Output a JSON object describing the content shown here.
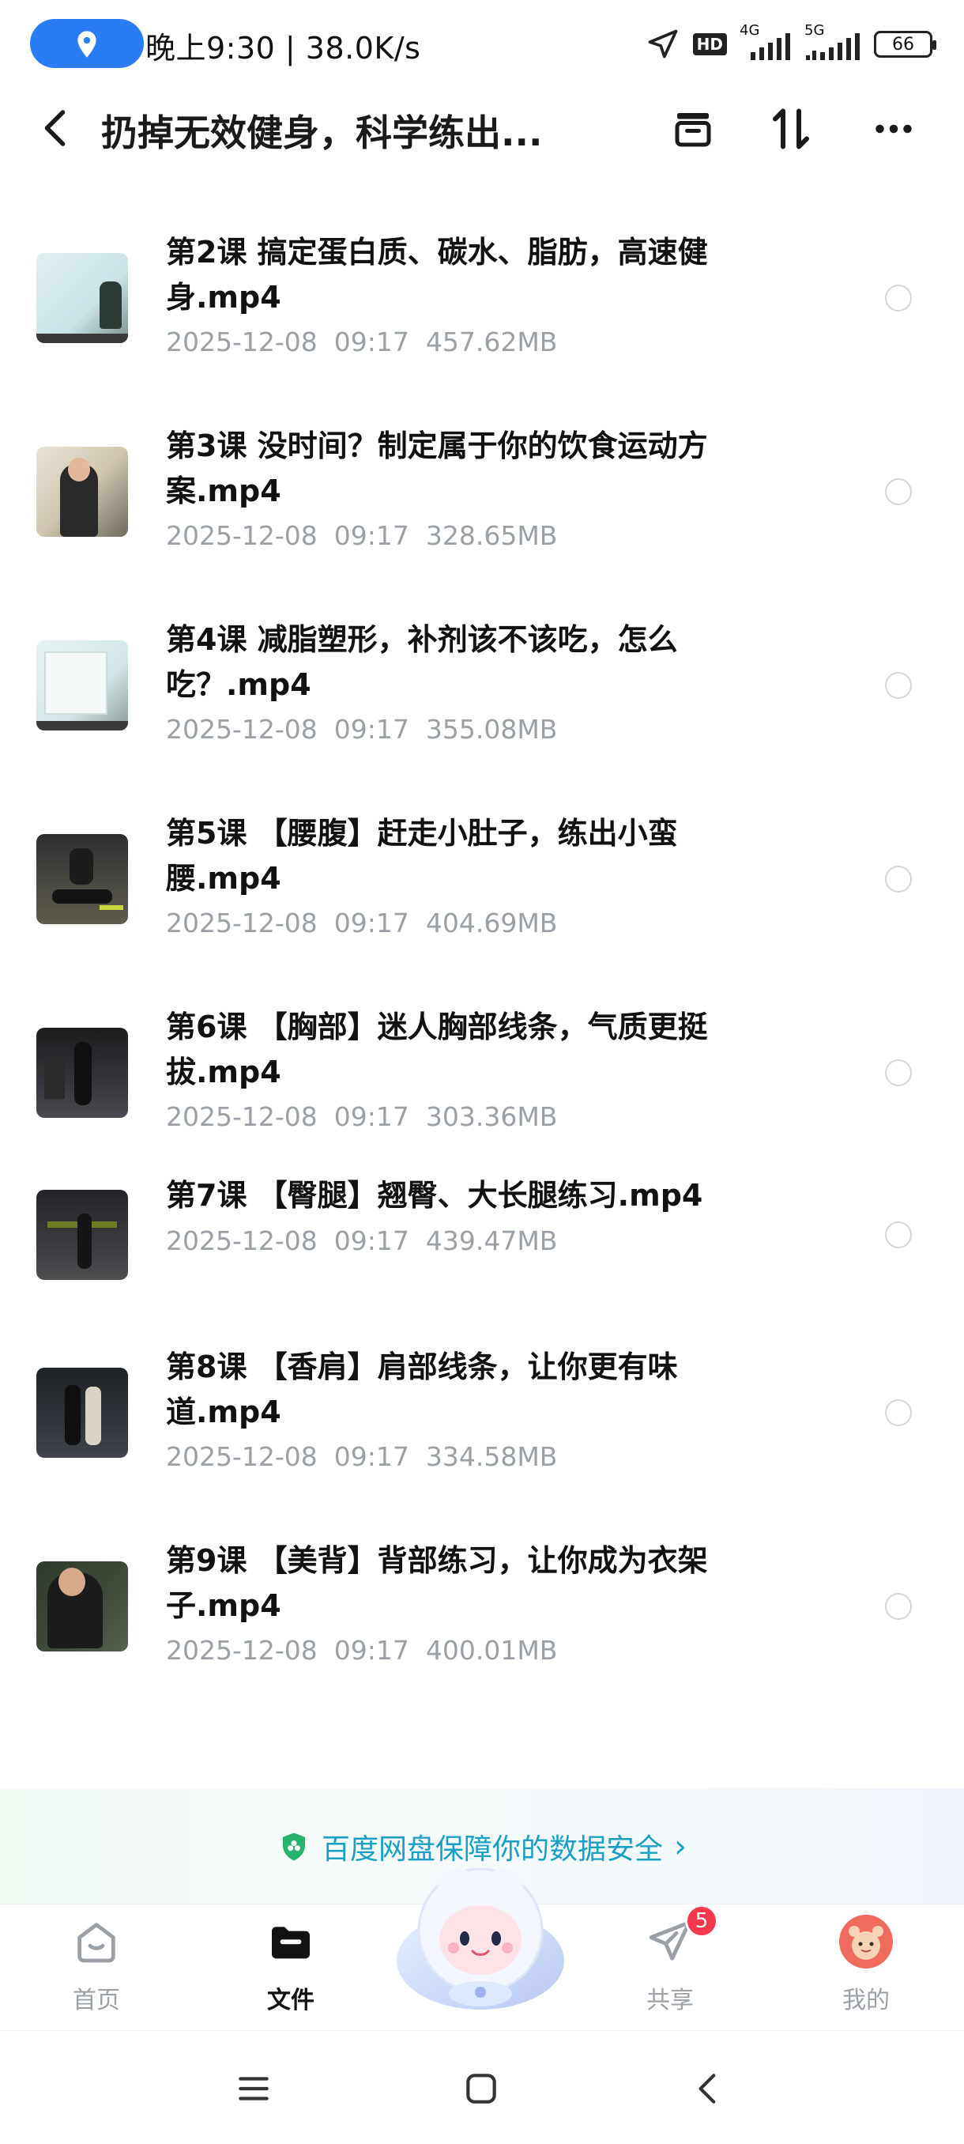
{
  "status_bar": {
    "time_speed": "晚上9:30 | 38.0K/s",
    "hd_label": "HD",
    "net1": "4G",
    "net2": "5G",
    "battery": "66"
  },
  "header": {
    "title": "扔掉无效健身，科学练出...",
    "icons": [
      "back-icon",
      "inbox-icon",
      "sort-icon",
      "more-icon"
    ]
  },
  "files": [
    {
      "name": "第2课 搞定蛋白质、碳水、脂肪，高速健身.mp4",
      "date": "2025-12-08",
      "time": "09:17",
      "size": "457.62MB",
      "lines": 2
    },
    {
      "name": "第3课 没时间？制定属于你的饮食运动方案.mp4",
      "date": "2025-12-08",
      "time": "09:17",
      "size": "328.65MB",
      "lines": 2
    },
    {
      "name": "第4课 减脂塑形，补剂该不该吃，怎么吃？.mp4",
      "date": "2025-12-08",
      "time": "09:17",
      "size": "355.08MB",
      "lines": 2
    },
    {
      "name": "第5课 【腰腹】赶走小肚子，练出小蛮腰.mp4",
      "date": "2025-12-08",
      "time": "09:17",
      "size": "404.69MB",
      "lines": 2
    },
    {
      "name": "第6课 【胸部】迷人胸部线条，气质更挺拔.mp4",
      "date": "2025-12-08",
      "time": "09:17",
      "size": "303.36MB",
      "lines": 2
    },
    {
      "name": "第7课 【臀腿】翘臀、大长腿练习.mp4",
      "date": "2025-12-08",
      "time": "09:17",
      "size": "439.47MB",
      "lines": 1
    },
    {
      "name": "第8课 【香肩】肩部线条，让你更有味道.mp4",
      "date": "2025-12-08",
      "time": "09:17",
      "size": "334.58MB",
      "lines": 2
    },
    {
      "name": "第9课 【美背】背部练习，让你成为衣架子.mp4",
      "date": "2025-12-08",
      "time": "09:17",
      "size": "400.01MB",
      "lines": 2
    }
  ],
  "safety_banner": {
    "text": "百度网盘保障你的数据安全",
    "arrow": "›"
  },
  "bottom_nav": {
    "items": [
      {
        "label": "首页",
        "icon": "home-icon",
        "active": false
      },
      {
        "label": "文件",
        "icon": "folder-icon",
        "active": true
      },
      {
        "label": "共享",
        "icon": "share-icon",
        "active": false,
        "badge": "5"
      },
      {
        "label": "我的",
        "icon": "avatar-icon",
        "active": false
      }
    ]
  },
  "colors": {
    "accent": "#2a7cf4",
    "banner_text": "#1a9fc4",
    "badge": "#f5384b",
    "meta": "#9aa0a6"
  }
}
